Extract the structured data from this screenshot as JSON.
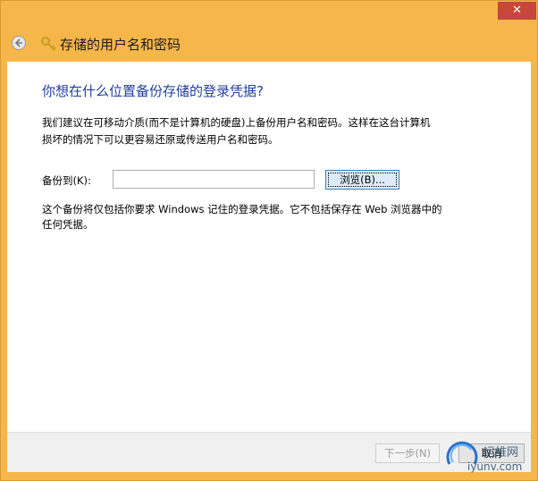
{
  "window": {
    "title": "存储的用户名和密码",
    "close_glyph": "✕"
  },
  "main": {
    "heading": "你想在什么位置备份存储的登录凭据?",
    "description": "我们建议在可移动介质(而不是计算机的硬盘)上备份用户名和密码。这样在这台计算机损坏的情况下可以更容易还原或传送用户名和密码。",
    "backup_label": "备份到(K):",
    "backup_value": "",
    "browse_button": "浏览(B)...",
    "note": "这个备份将仅包括你要求 Windows 记住的登录凭据。它不包括保存在 Web 浏览器中的任何凭据。"
  },
  "footer": {
    "next_button": "下一步(N)",
    "cancel_button": "取消"
  },
  "watermark": {
    "brand": "运维网",
    "url": "iyunv.com"
  },
  "icons": {
    "back": "back-arrow-icon",
    "key": "key-icon",
    "logo": "watermark-logo-icon"
  },
  "colors": {
    "title_bar": "#f6b649",
    "heading_blue": "#1f3f9a",
    "close_red": "#c7463e"
  }
}
